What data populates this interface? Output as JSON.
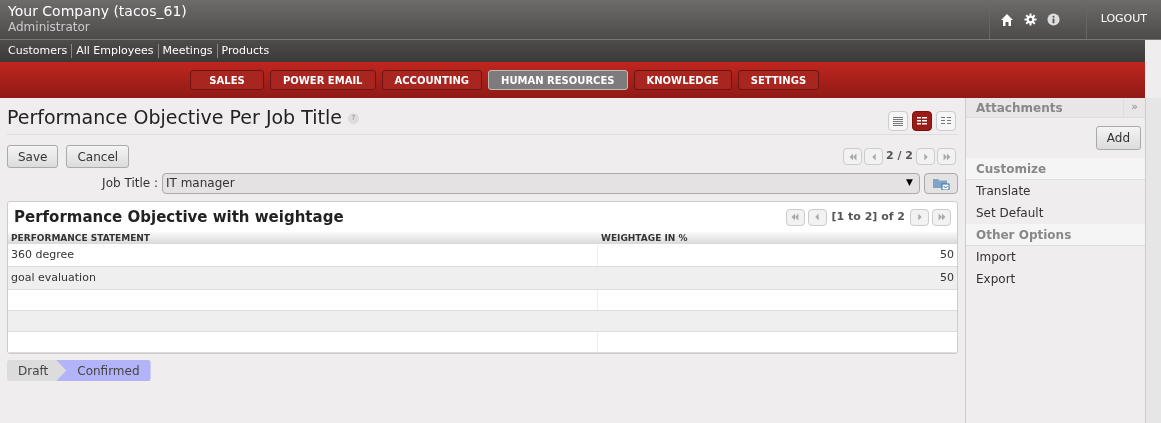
{
  "header": {
    "company": "Your Company (tacos_61)",
    "user": "Administrator",
    "logout": "LOGOUT"
  },
  "shortcuts": [
    "Customers",
    "All Employees",
    "Meetings",
    "Products"
  ],
  "menu": [
    {
      "label": "SALES",
      "selected": false
    },
    {
      "label": "POWER EMAIL",
      "selected": false
    },
    {
      "label": "ACCOUNTING",
      "selected": false
    },
    {
      "label": "HUMAN RESOURCES",
      "selected": true
    },
    {
      "label": "KNOWLEDGE",
      "selected": false
    },
    {
      "label": "SETTINGS",
      "selected": false
    }
  ],
  "page": {
    "title": "Performance Objective Per Job Title",
    "help": "?",
    "views": [
      {
        "kind": "list",
        "selected": false
      },
      {
        "kind": "form",
        "selected": true
      },
      {
        "kind": "calendar",
        "selected": false
      }
    ],
    "buttons": [
      "Save",
      "Cancel"
    ],
    "pager": "2 / 2",
    "field": {
      "label": "Job Title :",
      "value": "IT manager",
      "dropdown": "▼"
    }
  },
  "table": {
    "title": "Performance Objective with weightage",
    "pager": "[1 to 2] of 2",
    "columns": [
      "PERFORMANCE STATEMENT",
      "WEIGHTAGE IN %"
    ],
    "rows": [
      [
        "360 degree",
        "50"
      ],
      [
        "goal evaluation",
        "50"
      ]
    ]
  },
  "states": [
    {
      "label": "Draft",
      "selected": false
    },
    {
      "label": "Confirmed",
      "selected": true
    }
  ],
  "sidebar": {
    "attachments": "Attachments",
    "collapse": "»",
    "add": "Add",
    "sections": [
      {
        "title": "Customize",
        "items": [
          "Translate",
          "Set Default"
        ]
      },
      {
        "title": "Other Options",
        "items": [
          "Import",
          "Export"
        ]
      }
    ]
  }
}
